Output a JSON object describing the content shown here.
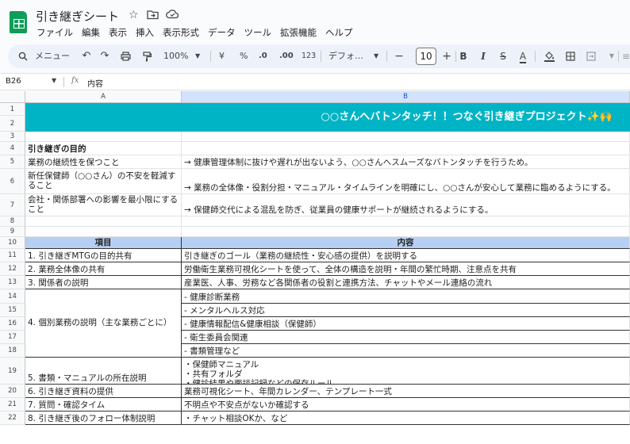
{
  "app": {
    "title": "引き継ぎシート",
    "title_icons": [
      "star-icon",
      "move-to-folder-icon",
      "cloud-saved-icon"
    ]
  },
  "menu": [
    "ファイル",
    "編集",
    "表示",
    "挿入",
    "表示形式",
    "データ",
    "ツール",
    "拡張機能",
    "ヘルプ"
  ],
  "toolbar": {
    "search": "メニュー",
    "zoom": "100%",
    "currency": "¥",
    "percent": "%",
    "dec_decrease": ".0",
    "dec_increase": ".00",
    "format_123": "123",
    "font": "デフォ…",
    "font_size": "10"
  },
  "formula_bar": {
    "cell_ref": "B26",
    "fx": "fx",
    "value": "内容"
  },
  "columns": [
    "A",
    "B"
  ],
  "rows": [
    "1",
    "2",
    "3",
    "4",
    "5",
    "6",
    "7",
    "8",
    "9",
    "10",
    "11",
    "12",
    "13",
    "14",
    "15",
    "16",
    "17",
    "18",
    "19",
    "20",
    "21",
    "22"
  ],
  "sheet": {
    "banner": "○○さんへバトンタッチ！！つなぐ引き継ぎプロジェクト✨🙌",
    "purpose_title": "引き継ぎの目的",
    "purposes": [
      {
        "a": "業務の継続性を保つこと",
        "b": "→ 健康管理体制に抜けや遅れが出ないよう、○○さんへスムーズなバトンタッチを行うため。"
      },
      {
        "a": "新任保健師（○○さん）の不安を軽減すること",
        "b": "→ 業務の全体像・役割分担・マニュアル・タイムラインを明確にし、○○さんが安心して業務に臨めるようにする。"
      },
      {
        "a": "会社・関係部署への影響を最小限にすること",
        "b": "→ 保健師交代による混乱を防ぎ、従業員の健康サポートが継続されるようにする。"
      }
    ],
    "table_header": {
      "a": "項目",
      "b": "内容"
    },
    "items": [
      {
        "a": "1. 引き継ぎMTGの目的共有",
        "b": "引き継ぎのゴール（業務の継続性・安心感の提供）を説明する"
      },
      {
        "a": "2. 業務全体像の共有",
        "b": "労働衛生業務可視化シートを使って、全体の構造を説明・年間の繁忙時期、注意点を共有"
      },
      {
        "a": "3. 関係者の説明",
        "b": "産業医、人事、労務など各関係者の役割と連携方法、チャットやメール連絡の流れ"
      },
      {
        "a": "4. 個別業務の説明（主な業務ごとに）",
        "b": [
          "- 健康診断業務",
          "- メンタルヘルス対応",
          "- 健康情報配信&健康相談（保健師）",
          "- 衛生委員会関連",
          "- 書類管理など"
        ]
      },
      {
        "a": "5. 書類・マニュアルの所在説明",
        "b": [
          "・保健師マニュアル",
          "・共有フォルダ",
          "・健診結果や面談記録などの保存ルール"
        ]
      },
      {
        "a": "6. 引き継ぎ資料の提供",
        "b": "業務可視化シート、年間カレンダー、テンプレート一式"
      },
      {
        "a": "7. 質問・確認タイム",
        "b": "不明点や不安点がないか確認する"
      },
      {
        "a": "8. 引き継ぎ後のフォロー体制説明",
        "b": "・チャット相談OKか、など"
      }
    ]
  },
  "colors": {
    "banner": "#00b4c5",
    "header": "#b7cff3",
    "selection": "#1a73e8"
  }
}
